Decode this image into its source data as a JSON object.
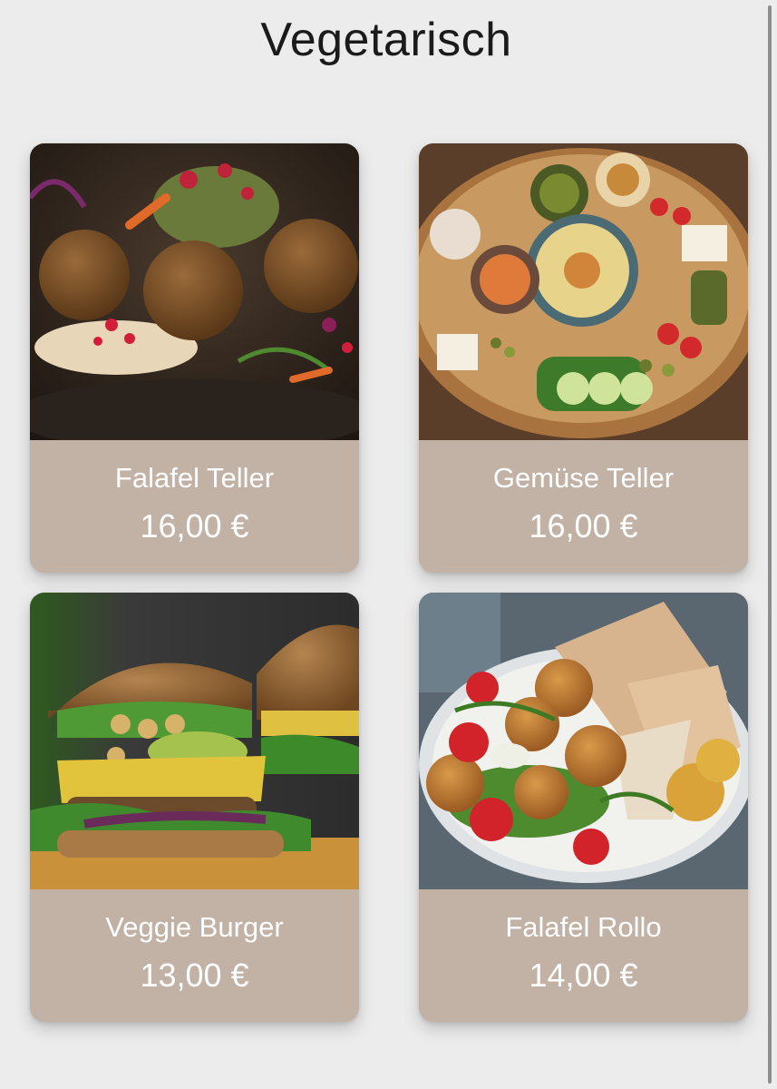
{
  "page": {
    "title": "Vegetarisch"
  },
  "items": [
    {
      "name": "Falafel Teller",
      "price": "16,00 €",
      "image_icon": "falafel-plate-image"
    },
    {
      "name": "Gemüse Teller",
      "price": "16,00 €",
      "image_icon": "vegetable-platter-image"
    },
    {
      "name": "Veggie Burger",
      "price": "13,00 €",
      "image_icon": "veggie-burger-image"
    },
    {
      "name": "Falafel Rollo",
      "price": "14,00 €",
      "image_icon": "falafel-wrap-image"
    }
  ],
  "colors": {
    "background": "#ececec",
    "card_footer": "#c2b2a6",
    "card_text": "#ffffff",
    "title_text": "#1b1b1b"
  }
}
